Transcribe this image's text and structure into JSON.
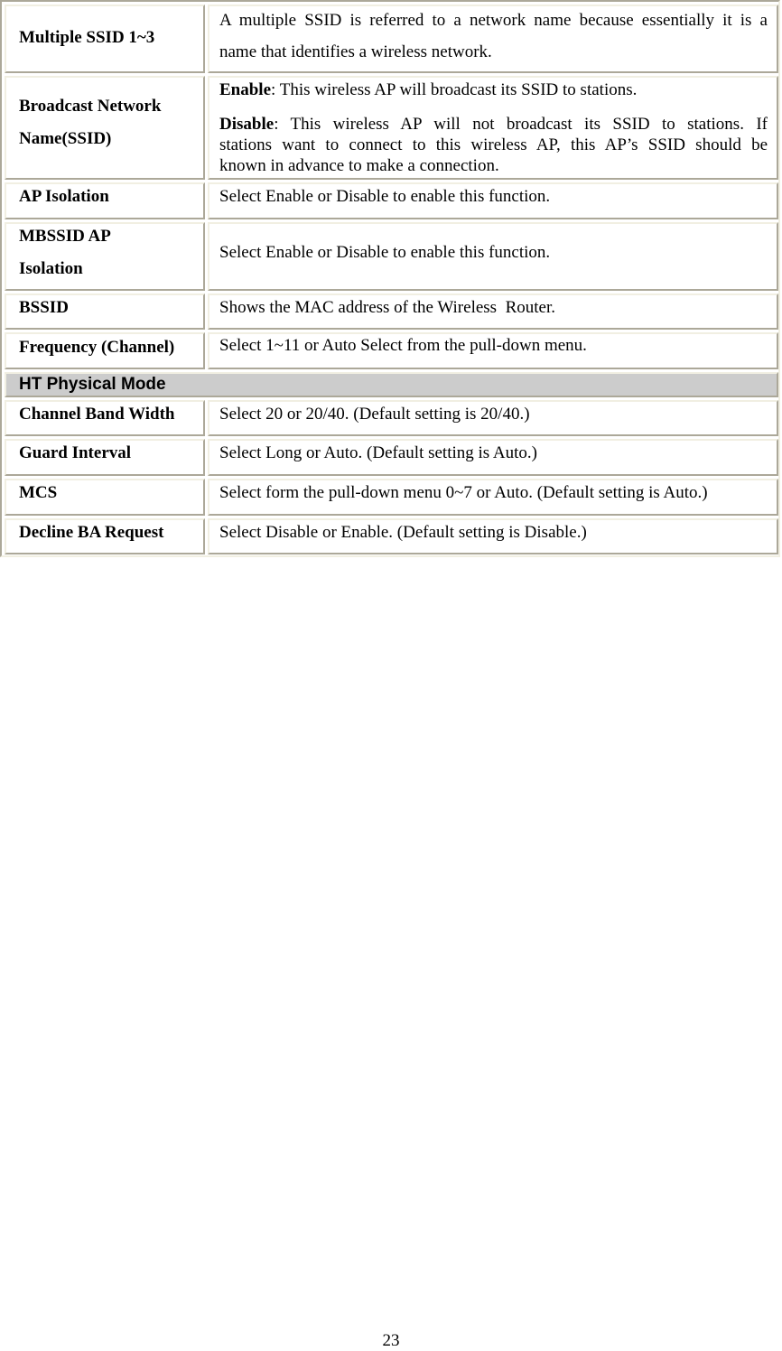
{
  "table": {
    "rows_group1": [
      {
        "label": "Multiple SSID 1~3",
        "description_lines": [
          "A multiple SSID is referred to a network name because essentially it is a",
          "name that identifies a wireless network."
        ]
      },
      {
        "label_lines": [
          "Broadcast Network",
          "Name(SSID)"
        ],
        "enable_term": "Enable",
        "enable_text": ": This wireless AP will broadcast its SSID to stations.",
        "disable_term": "Disable",
        "disable_text_lines": [
          ": This wireless AP will not broadcast its SSID to stations. If",
          "stations want to connect to this wireless AP, this AP’s SSID should be",
          "known in advance to make a connection."
        ]
      },
      {
        "label": "AP Isolation",
        "description": "Select Enable or Disable to enable this function."
      },
      {
        "label_lines": [
          "MBSSID AP",
          "Isolation"
        ],
        "description": "Select Enable or Disable to enable this function."
      },
      {
        "label": "BSSID",
        "description": "Shows the MAC address of the Wireless  Router."
      },
      {
        "label": "Frequency (Channel)",
        "description": "Select 1~11 or Auto Select from the pull-down menu."
      }
    ],
    "section_header": "HT Physical Mode",
    "rows_group2": [
      {
        "label": "Channel Band Width",
        "description": "Select 20 or 20/40. (Default setting is 20/40.)"
      },
      {
        "label": "Guard Interval",
        "description": "Select Long or Auto. (Default setting is Auto.)"
      },
      {
        "label": "MCS",
        "description": "Select form the pull-down menu 0~7 or Auto. (Default setting is Auto.)"
      },
      {
        "label": "Decline BA Request",
        "description": "Select Disable or Enable. (Default setting is Disable.)"
      }
    ]
  },
  "colors": {
    "section_background": "#cccccc",
    "border_dark": "#aca899",
    "border_light": "#f1efe2"
  },
  "footer": {
    "page_number": "23"
  }
}
